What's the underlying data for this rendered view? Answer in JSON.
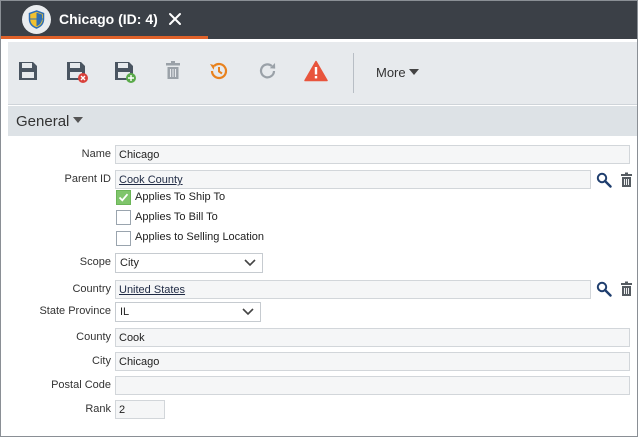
{
  "tab": {
    "title": "Chicago (ID: 4)"
  },
  "toolbar": {
    "more_label": "More"
  },
  "section": {
    "title": "General"
  },
  "form": {
    "name": {
      "label": "Name",
      "value": "Chicago"
    },
    "parent_id": {
      "label": "Parent ID",
      "value": "Cook County"
    },
    "applies_ship_to": {
      "label": "Applies To Ship To",
      "checked": true
    },
    "applies_bill_to": {
      "label": "Applies To Bill To",
      "checked": false
    },
    "applies_selling": {
      "label": "Applies to Selling Location",
      "checked": false
    },
    "scope": {
      "label": "Scope",
      "value": "City"
    },
    "country": {
      "label": "Country",
      "value": "United States"
    },
    "state_province": {
      "label": "State Province",
      "value": "IL"
    },
    "county": {
      "label": "County",
      "value": "Cook"
    },
    "city": {
      "label": "City",
      "value": "Chicago"
    },
    "postal_code": {
      "label": "Postal Code",
      "value": ""
    },
    "rank": {
      "label": "Rank",
      "value": "2"
    }
  },
  "colors": {
    "accent": "#e0622a",
    "tabbar": "#3b4047",
    "checkbox_checked": "#7fc56b",
    "warning": "#e8553d"
  },
  "icons": [
    "shield-icon",
    "close-icon",
    "save-icon",
    "save-close-icon",
    "save-new-icon",
    "delete-icon",
    "history-icon",
    "refresh-icon",
    "warning-icon",
    "search-icon",
    "trash-icon",
    "chevron-down-icon"
  ]
}
